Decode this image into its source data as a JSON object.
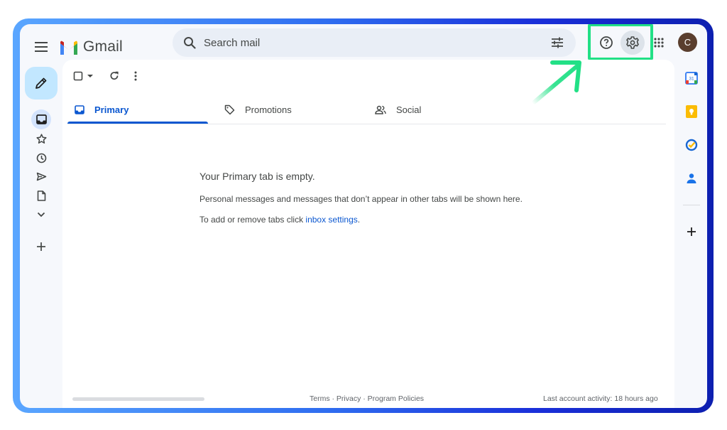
{
  "app": {
    "name": "Gmail",
    "avatar_letter": "C"
  },
  "search": {
    "placeholder": "Search mail"
  },
  "tabs": [
    {
      "label": "Primary",
      "icon": "inbox-icon",
      "active": true
    },
    {
      "label": "Promotions",
      "icon": "tag-icon",
      "active": false
    },
    {
      "label": "Social",
      "icon": "people-icon",
      "active": false
    }
  ],
  "empty_state": {
    "title": "Your Primary tab is empty.",
    "description": "Personal messages and messages that don’t appear in other tabs will be shown here.",
    "tabs_prefix": "To add or remove tabs click ",
    "tabs_link": "inbox settings",
    "tabs_suffix": "."
  },
  "footer": {
    "links": "Terms · Privacy · Program Policies",
    "activity": "Last account activity: 18 hours ago"
  },
  "side_panel": {
    "calendar_day": "31"
  },
  "colors": {
    "accent": "#0b57d0",
    "highlight": "#22e086",
    "compose_bg": "#c2e7ff"
  },
  "icons": [
    "menu-icon",
    "gmail-logo",
    "search-icon",
    "tune-icon",
    "help-icon",
    "settings-icon",
    "apps-grid-icon",
    "pencil-icon",
    "inbox-icon",
    "star-icon",
    "clock-icon",
    "send-icon",
    "draft-icon",
    "chevron-down-icon",
    "plus-icon",
    "checkbox-icon",
    "refresh-icon",
    "more-vert-icon",
    "calendar-icon",
    "keep-icon",
    "tasks-icon",
    "contacts-icon"
  ]
}
